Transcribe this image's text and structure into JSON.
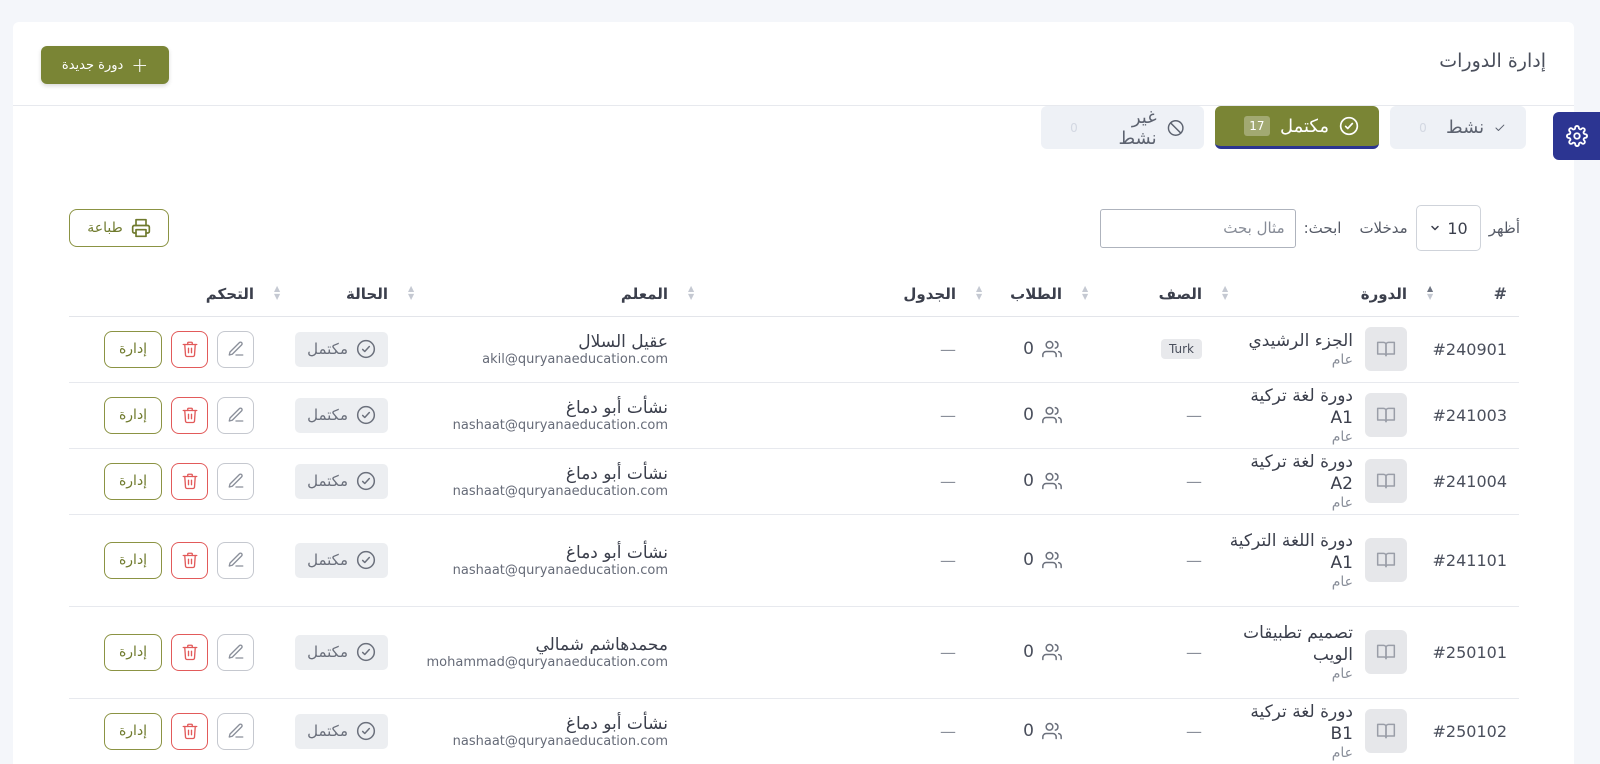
{
  "header": {
    "title": "إدارة الدورات",
    "new_course_label": "دورة جديدة"
  },
  "filters": [
    {
      "label": "نشط",
      "count": "0",
      "state": "light"
    },
    {
      "label": "مكتمل",
      "count": "17",
      "state": "active"
    },
    {
      "label": "غير نشط",
      "count": "0",
      "state": "light"
    }
  ],
  "controls": {
    "show_label": "أظهر",
    "page_length": "10",
    "entries_label": "مدخلات",
    "search_label": "ابحث:",
    "search_placeholder": "مثال بحث",
    "print_label": "طباعة"
  },
  "table": {
    "columns": [
      "#",
      "الدورة",
      "الصف",
      "الطلاب",
      "الجدول",
      "المعلم",
      "الحالة",
      "التحكم"
    ],
    "rows": [
      {
        "id": "#240901",
        "course": "الجزء الرشيدي",
        "type": "عام",
        "class": "Turk",
        "students": "0",
        "schedule": "—",
        "teacher": "عقيل السلال",
        "email": "akil@quryanaeducation.com",
        "status": "مكتمل",
        "h": 66
      },
      {
        "id": "#241003",
        "course": "دورة لغة تركية A1",
        "type": "عام",
        "class": "",
        "students": "0",
        "schedule": "—",
        "teacher": "نشأت أبو دماغ",
        "email": "nashaat@quryanaeducation.com",
        "status": "مكتمل",
        "h": 66
      },
      {
        "id": "#241004",
        "course": "دورة لغة تركية A2",
        "type": "عام",
        "class": "",
        "students": "0",
        "schedule": "—",
        "teacher": "نشأت أبو دماغ",
        "email": "nashaat@quryanaeducation.com",
        "status": "مكتمل",
        "h": 66
      },
      {
        "id": "#241101",
        "course": "دورة اللغة التركية A1",
        "type": "عام",
        "class": "",
        "students": "0",
        "schedule": "—",
        "teacher": "نشأت أبو دماغ",
        "email": "nashaat@quryanaeducation.com",
        "status": "مكتمل",
        "h": 92
      },
      {
        "id": "#250101",
        "course": "تصميم تطبيقات الويب",
        "type": "عام",
        "class": "",
        "students": "0",
        "schedule": "—",
        "teacher": "محمدهاشم شمالي",
        "email": "mohammad@quryanaeducation.com",
        "status": "مكتمل",
        "h": 92
      },
      {
        "id": "#250102",
        "course": "دورة لغة تركية B1",
        "type": "عام",
        "class": "",
        "students": "0",
        "schedule": "—",
        "teacher": "نشأت أبو دماغ",
        "email": "nashaat@quryanaeducation.com",
        "status": "مكتمل",
        "h": 66
      }
    ],
    "manage_label": "إدارة"
  },
  "colors": {
    "primary": "#7a8535",
    "sidebar_tab": "#2c3592",
    "danger": "#e25a5a"
  },
  "icons": {
    "settings": "gear-icon",
    "new": "plus-icon",
    "print": "printer-icon",
    "course": "book-icon",
    "students": "users-icon",
    "status": "check-circle-icon",
    "edit": "pencil-icon",
    "delete": "trash-icon"
  }
}
